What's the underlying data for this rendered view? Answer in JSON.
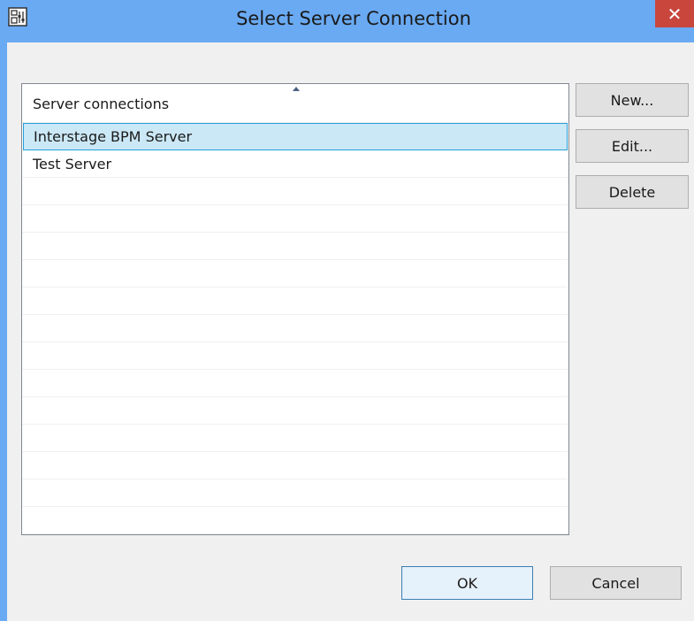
{
  "window": {
    "title": "Select Server Connection",
    "close_symbol": "✕",
    "app_icon": "settings-dialog-icon"
  },
  "list": {
    "header": "Server connections",
    "sort": "ascending",
    "items": [
      {
        "label": "Interstage BPM Server",
        "selected": true
      },
      {
        "label": "Test Server",
        "selected": false
      }
    ]
  },
  "buttons": {
    "new": "New...",
    "edit": "Edit...",
    "delete": "Delete",
    "ok": "OK",
    "cancel": "Cancel"
  },
  "colors": {
    "title_bar": "#6aaaf3",
    "close_button": "#c9463d",
    "selection_fill": "#cbe8f6",
    "selection_border": "#26a0da"
  }
}
